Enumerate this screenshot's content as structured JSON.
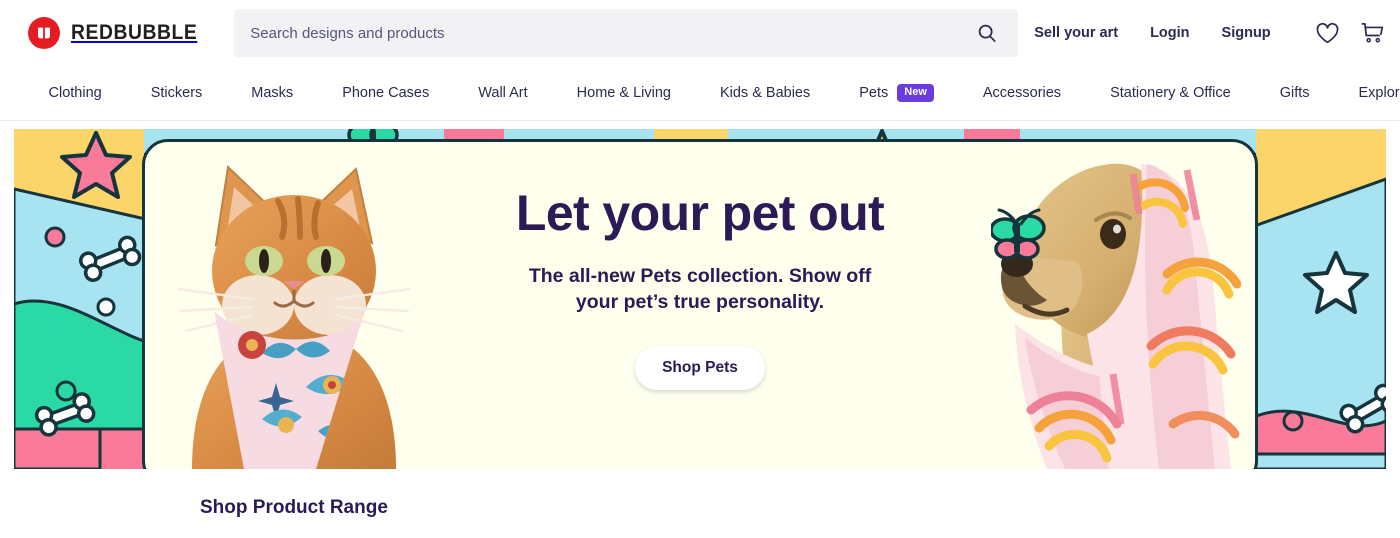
{
  "header": {
    "brand": {
      "name": "REDBUBBLE",
      "logo_icon": "redbubble-logo-icon",
      "logo_color": "#E61C24"
    },
    "search": {
      "placeholder": "Search designs and products",
      "value": "",
      "icon": "search-icon"
    },
    "links": [
      {
        "label": "Sell your art",
        "name": "sell-your-art-link"
      },
      {
        "label": "Login",
        "name": "login-link"
      },
      {
        "label": "Signup",
        "name": "signup-link"
      }
    ],
    "icons": [
      {
        "label": "Favourites",
        "icon": "heart-icon"
      },
      {
        "label": "Cart",
        "icon": "cart-icon"
      }
    ]
  },
  "nav": {
    "items": [
      {
        "label": "Clothing"
      },
      {
        "label": "Stickers"
      },
      {
        "label": "Masks"
      },
      {
        "label": "Phone Cases"
      },
      {
        "label": "Wall Art"
      },
      {
        "label": "Home & Living"
      },
      {
        "label": "Kids & Babies"
      },
      {
        "label": "Pets",
        "badge": "New"
      },
      {
        "label": "Accessories"
      },
      {
        "label": "Stationery & Office"
      },
      {
        "label": "Gifts"
      },
      {
        "label": "Explore designs"
      }
    ],
    "badge_color": "#6A3BE0"
  },
  "hero": {
    "title": "Let your pet out",
    "subtitle_line1": "The all-new Pets collection. Show off",
    "subtitle_line2": "your pet’s true personality.",
    "cta_label": "Shop Pets",
    "card_background": "#FEFFED",
    "border_color": "#15343C",
    "text_color": "#2B1A55",
    "decor_colors": {
      "yellow": "#FBD46A",
      "light_blue": "#A7E3F0",
      "green": "#2BD9A4",
      "pink": "#F97A99",
      "teal_line": "#15343C"
    },
    "left_image_alt": "Orange tabby cat wearing a pink tattoo-print bandana",
    "right_image_alt": "Golden retriever draped in a pink and orange striped towel with a teal butterfly on its nose"
  },
  "section": {
    "title": "Shop Product Range"
  }
}
